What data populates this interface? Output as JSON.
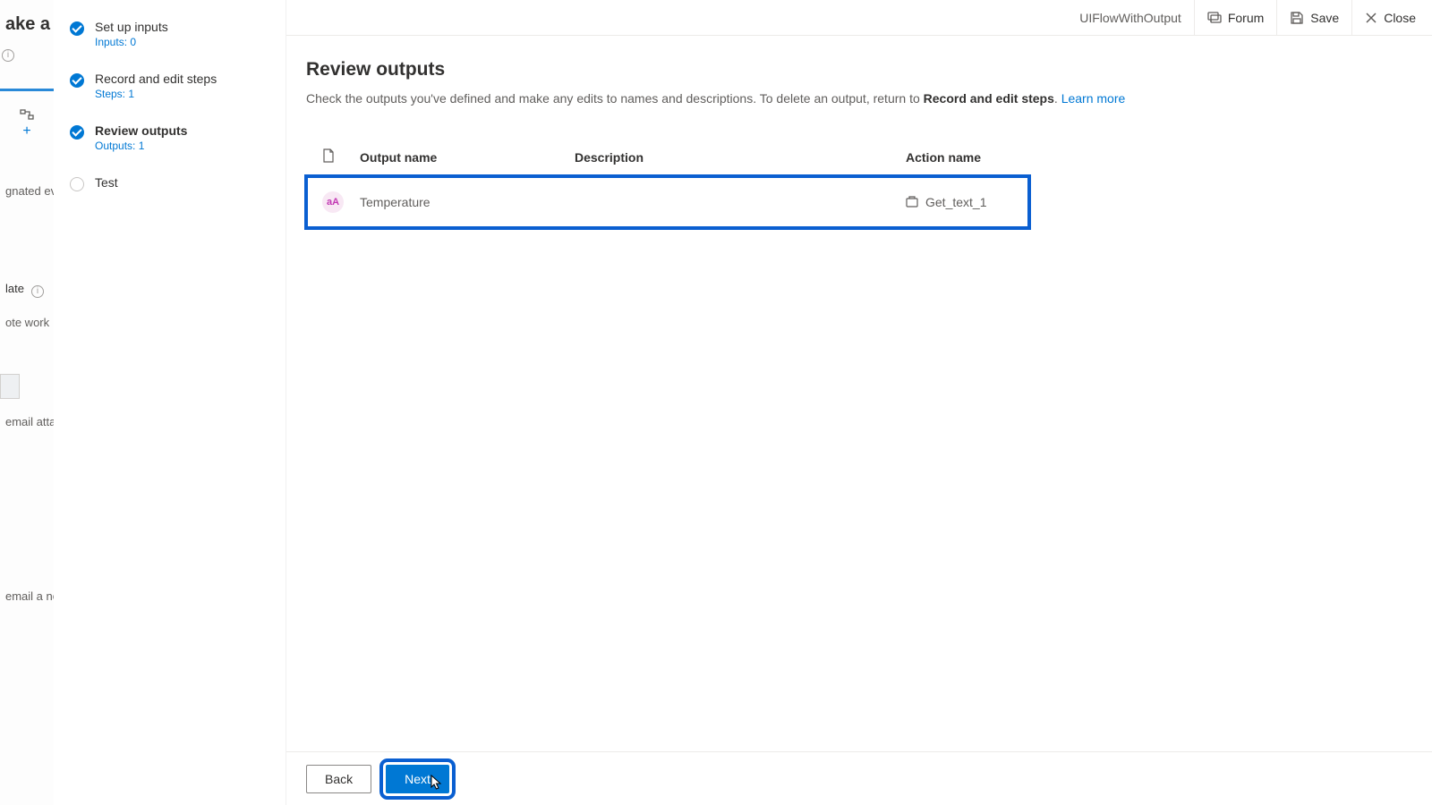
{
  "bg": {
    "title": "ake a flo",
    "frag1": "gnated even",
    "tmpl": "late",
    "frag2": "ote work",
    "frag3": "email attac",
    "frag4": "email a no"
  },
  "steps": [
    {
      "label": "Set up inputs",
      "sub": "Inputs: 0",
      "state": "done"
    },
    {
      "label": "Record and edit steps",
      "sub": "Steps: 1",
      "state": "done"
    },
    {
      "label": "Review outputs",
      "sub": "Outputs: 1",
      "state": "current"
    },
    {
      "label": "Test",
      "sub": "",
      "state": "pending"
    }
  ],
  "header": {
    "flowName": "UIFlowWithOutput",
    "forum": "Forum",
    "save": "Save",
    "close": "Close"
  },
  "page": {
    "title": "Review outputs",
    "descPrefix": "Check the outputs you've defined and make any edits to names and descriptions. To delete an output, return to ",
    "descStrong": "Record and edit steps",
    "descSuffix": ". ",
    "learnMore": "Learn more"
  },
  "table": {
    "colOutput": "Output name",
    "colDescription": "Description",
    "colAction": "Action name",
    "rows": [
      {
        "iconText": "aA",
        "name": "Temperature",
        "description": "",
        "action": "Get_text_1"
      }
    ]
  },
  "footer": {
    "back": "Back",
    "next": "Next"
  }
}
